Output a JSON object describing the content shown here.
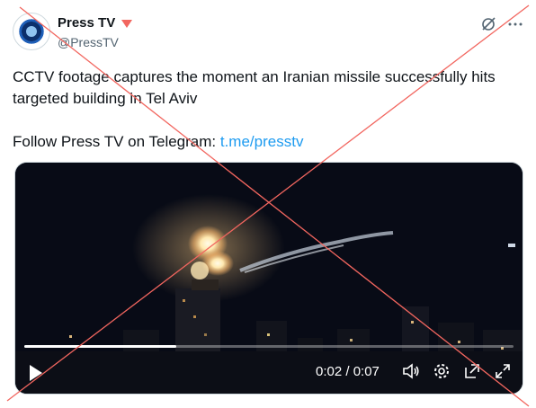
{
  "author": {
    "display_name": "Press TV",
    "handle": "@PressTV"
  },
  "tweet": {
    "text": "CCTV footage captures the moment an Iranian missile successfully hits targeted building in Tel Aviv",
    "follow_prefix": "Follow Press TV on Telegram: ",
    "link_text": "t.me/presstv"
  },
  "video": {
    "time_display": "0:02 / 0:07",
    "progress_fraction": 0.31
  },
  "icons": [
    "avatar",
    "badge-triangle-icon",
    "grok-icon",
    "more-icon",
    "play-icon",
    "volume-icon",
    "settings-icon",
    "pip-icon",
    "fullscreen-icon"
  ],
  "colors": {
    "link": "#1d9bf0",
    "handle": "#536471",
    "badge": "#f2665f",
    "cross_out": "#f2665f"
  }
}
